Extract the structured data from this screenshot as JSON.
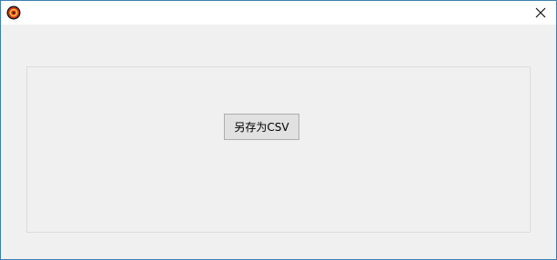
{
  "window": {
    "title": "",
    "close_glyph": "✕",
    "icon": "app-target-icon",
    "border_color": "#3c7fb1",
    "background_color": "#f0f0f0"
  },
  "main": {
    "save_csv_button": "另存为CSV"
  }
}
